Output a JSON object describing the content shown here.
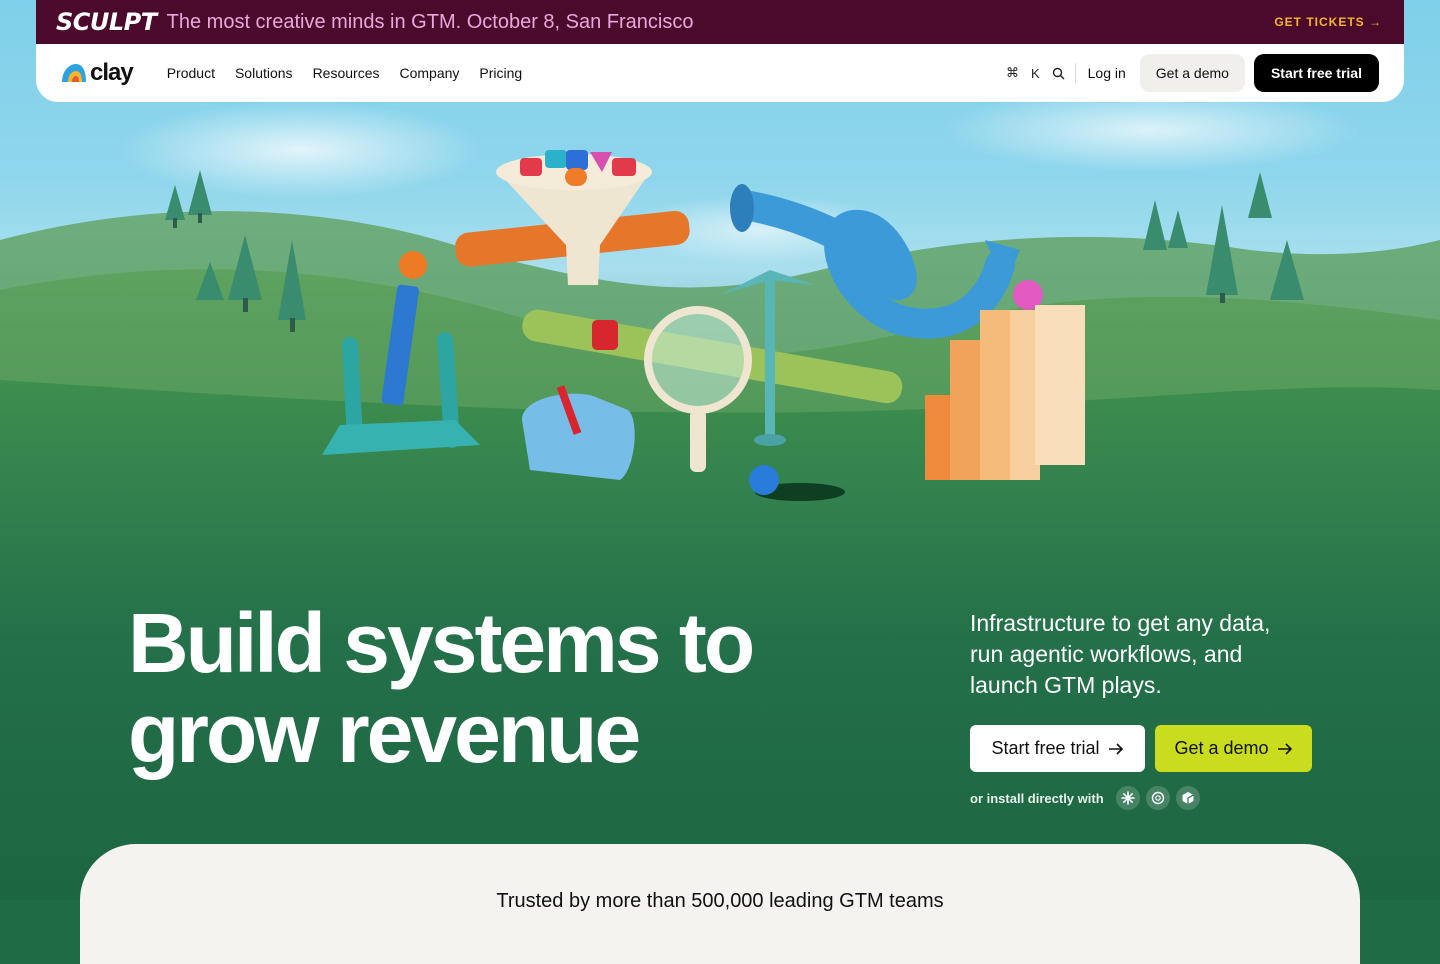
{
  "announcement": {
    "brand": "SCULPT",
    "message": "The most creative minds in GTM. October 8, San Francisco",
    "cta": "GET TICKETS →"
  },
  "nav": {
    "logo_text": "clay",
    "links": [
      "Product",
      "Solutions",
      "Resources",
      "Company",
      "Pricing"
    ],
    "shortcut_key": "K",
    "login": "Log in",
    "demo": "Get a demo",
    "trial": "Start free trial"
  },
  "hero": {
    "headline_line1": "Build systems to",
    "headline_line2": "grow revenue",
    "subheadline": "Infrastructure to get any data, run agentic workflows, and launch GTM plays.",
    "trial_button": "Start free trial",
    "demo_button": "Get a demo",
    "install_label": "or install directly with",
    "install_icons": [
      "claude-icon",
      "openai-icon",
      "cursor-icon"
    ]
  },
  "trusted": {
    "text": "Trusted by more than 500,000 leading GTM teams"
  },
  "colors": {
    "announcement_bg": "#4b0a2c",
    "ticket_accent": "#f2b731",
    "hero_green": "#1f6b45",
    "demo_button": "#c9dd1e"
  }
}
